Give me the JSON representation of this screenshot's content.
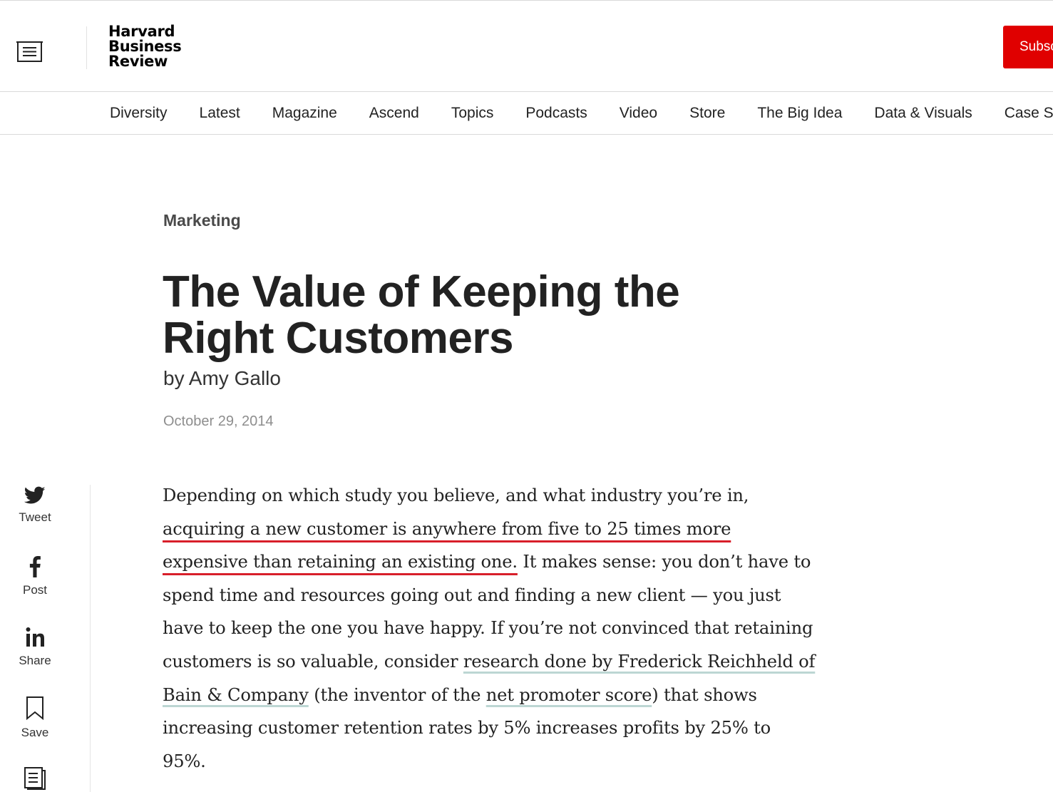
{
  "header": {
    "logo_lines": [
      "Harvard",
      "Business",
      "Review"
    ],
    "subscribe_label": "Subscribe"
  },
  "nav": {
    "items": [
      "Diversity",
      "Latest",
      "Magazine",
      "Ascend",
      "Topics",
      "Podcasts",
      "Video",
      "Store",
      "The Big Idea",
      "Data & Visuals",
      "Case Selections"
    ]
  },
  "article": {
    "topic": "Marketing",
    "title": "The Value of Keeping the Right Customers",
    "byline": "by Amy Gallo",
    "date": "October 29, 2014",
    "body": {
      "p1_start": "Depending on which study you believe, and what industry you’re in, ",
      "p1_highlight": "acquiring a new customer is anywhere from five to 25 times more expensive than retaining an existing one.",
      "p1_mid": " It makes sense: you don’t have to spend time and resources going out and finding a new client — you just have to keep the one you have happy. If you’re not convinced that retaining customers is so valuable, consider ",
      "link1": "research done by Frederick Reichheld of Bain & Company",
      "p1_mid2": " (the inventor of the ",
      "link2": "net promoter score",
      "p1_end": ") that shows increasing customer retention rates by 5% increases profits by 25% to 95%."
    }
  },
  "share": {
    "tweet_label": "Tweet",
    "post_label": "Post",
    "share_label": "Share",
    "save_label": "Save"
  },
  "colors": {
    "brand_red": "#e00000",
    "highlight_underline": "#d81f2a",
    "link_underline": "#bcd6d3"
  }
}
